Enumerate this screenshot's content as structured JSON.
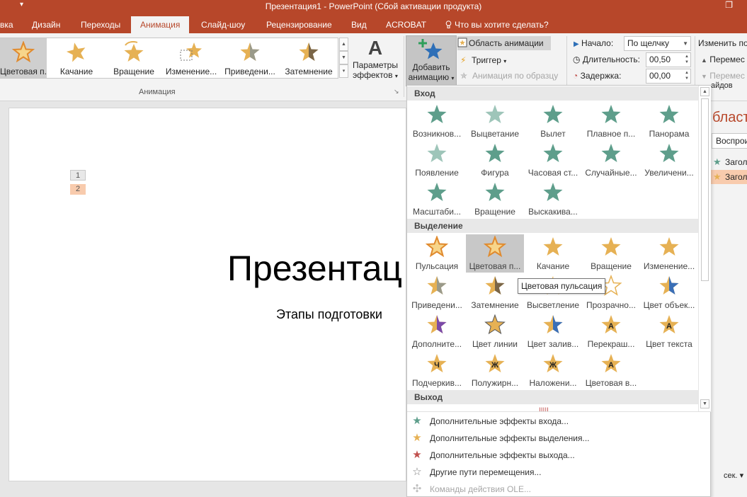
{
  "window": {
    "title": "Презентация1 - PowerPoint (Сбой активации продукта)",
    "qa_arrow": "▾",
    "restore_glyph": "❐"
  },
  "tabs": [
    {
      "label": "вка"
    },
    {
      "label": "Дизайн"
    },
    {
      "label": "Переходы"
    },
    {
      "label": "Анимация",
      "active": true
    },
    {
      "label": "Слайд-шоу"
    },
    {
      "label": "Рецензирование"
    },
    {
      "label": "Вид"
    },
    {
      "label": "ACROBAT"
    },
    {
      "label": "Что вы хотите сделать?"
    }
  ],
  "ribbon": {
    "gallery": [
      {
        "label": "Цветовая п...",
        "icon": "pulse-star-icon",
        "selected": true
      },
      {
        "label": "Качание",
        "icon": "teeter-star-icon"
      },
      {
        "label": "Вращение",
        "icon": "spin-star-icon"
      },
      {
        "label": "Изменение...",
        "icon": "grow-shrink-star-icon"
      },
      {
        "label": "Приведени...",
        "icon": "desaturate-star-icon"
      },
      {
        "label": "Затемнение",
        "icon": "darken-star-icon"
      }
    ],
    "effects_line1": "Параметры",
    "effects_line2": "эффектов",
    "effects_glyph": "A",
    "group_animation_label": "Анимация",
    "add_line1": "Добавить",
    "add_line2": "анимацию",
    "animation_pane": "Область анимации",
    "trigger": "Триггер",
    "painter": "Анимация по образцу",
    "start_label": "Начало:",
    "start_value": "По щелчку",
    "duration_label": "Длительность:",
    "duration_value": "00,50",
    "delay_label": "Задержка:",
    "delay_value": "00,00",
    "reorder_label": "Изменить по",
    "move_earlier": "Перемес",
    "move_later": "Перемес"
  },
  "slide": {
    "num1": "1",
    "num2": "2",
    "title": "Презентац",
    "subtitle": "Этапы подготовки"
  },
  "pane": {
    "title": "бласт",
    "play": "Воспрои",
    "item1": "Загол",
    "item2": "Загол",
    "section": "айдов",
    "seconds": "сек.",
    "seconds_arrow": "▾"
  },
  "dropdown": {
    "sections": {
      "entrance": "Вход",
      "emphasis": "Выделение",
      "exit": "Выход"
    },
    "entrance": [
      {
        "label": "Возникнов...",
        "icon": "appear-icon"
      },
      {
        "label": "Выцветание",
        "icon": "fade-icon"
      },
      {
        "label": "Вылет",
        "icon": "fly-in-icon"
      },
      {
        "label": "Плавное п...",
        "icon": "float-in-icon"
      },
      {
        "label": "Панорама",
        "icon": "split-icon"
      },
      {
        "label": "Появление",
        "icon": "wipe-icon"
      },
      {
        "label": "Фигура",
        "icon": "shape-icon"
      },
      {
        "label": "Часовая ст...",
        "icon": "wheel-icon"
      },
      {
        "label": "Случайные...",
        "icon": "random-bars-icon"
      },
      {
        "label": "Увеличени...",
        "icon": "grow-turn-icon"
      },
      {
        "label": "Масштаби...",
        "icon": "zoom-icon"
      },
      {
        "label": "Вращение",
        "icon": "swivel-icon"
      },
      {
        "label": "Выскакива...",
        "icon": "bounce-icon"
      }
    ],
    "emphasis": [
      {
        "label": "Пульсация",
        "icon": "pulse-icon"
      },
      {
        "label": "Цветовая п...",
        "icon": "color-pulse-icon",
        "selected": true
      },
      {
        "label": "Качание",
        "icon": "teeter-icon"
      },
      {
        "label": "Вращение",
        "icon": "spin-icon"
      },
      {
        "label": "Изменение...",
        "icon": "grow-shrink-icon"
      },
      {
        "label": "Приведени...",
        "icon": "desaturate-icon"
      },
      {
        "label": "Затемнение",
        "icon": "darken-icon"
      },
      {
        "label": "Высветление",
        "icon": "lighten-icon"
      },
      {
        "label": "Прозрачно...",
        "icon": "transparency-icon"
      },
      {
        "label": "Цвет объек...",
        "icon": "object-color-icon"
      },
      {
        "label": "Дополните...",
        "icon": "complementary-color-icon"
      },
      {
        "label": "Цвет линии",
        "icon": "line-color-icon"
      },
      {
        "label": "Цвет залив...",
        "icon": "fill-color-icon"
      },
      {
        "label": "Перекраш...",
        "icon": "brush-color-icon"
      },
      {
        "label": "Цвет текста",
        "icon": "font-color-icon"
      },
      {
        "label": "Подчеркив...",
        "icon": "underline-icon"
      },
      {
        "label": "Полужирн...",
        "icon": "bold-flash-icon"
      },
      {
        "label": "Наложени...",
        "icon": "bold-reveal-icon"
      },
      {
        "label": "Цветовая в...",
        "icon": "wave-icon"
      }
    ],
    "tooltip": "Цветовая пульсация",
    "more": [
      {
        "label": "Дополнительные эффекты входа...",
        "color": "#5e9e8b",
        "icon": "entrance-star-icon"
      },
      {
        "label": "Дополнительные эффекты выделения...",
        "color": "#e6b154",
        "icon": "emphasis-star-icon"
      },
      {
        "label": "Дополнительные эффекты выхода...",
        "color": "#c0504d",
        "icon": "exit-star-icon"
      },
      {
        "label": "Другие пути перемещения...",
        "color": "#7f7f7f",
        "icon": "motion-path-icon"
      },
      {
        "label": "Команды действия OLE...",
        "color": "#bfbfbf",
        "icon": "ole-action-icon",
        "disabled": true
      }
    ]
  },
  "colors": {
    "accent": "#b7472a",
    "entrance_green": "#5e9e8b",
    "emphasis_gold": "#e6b154",
    "exit_red": "#c0504d"
  }
}
